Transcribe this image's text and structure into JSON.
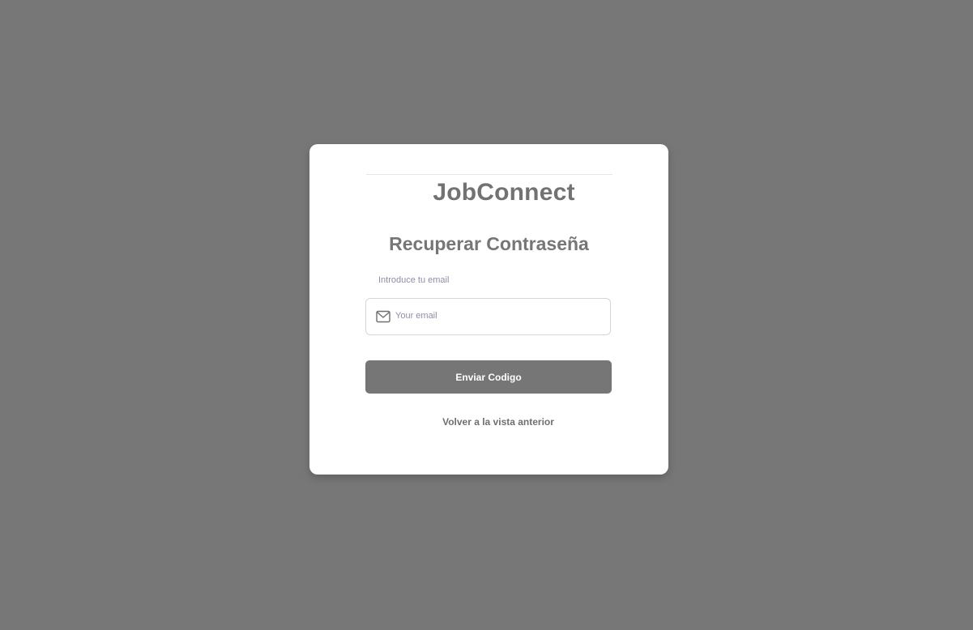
{
  "brand": {
    "name": "JobConnect"
  },
  "page": {
    "title": "Recuperar Contraseña"
  },
  "form": {
    "email_label": "Introduce tu email",
    "email_placeholder": "Your email",
    "email_value": "",
    "email_icon": "mail-icon",
    "submit_label": "Enviar Codigo",
    "back_label": "Volver a la vista anterior"
  },
  "colors": {
    "background": "#767776",
    "card": "#ffffff",
    "button": "#767676",
    "label": "#8c8fa6"
  }
}
